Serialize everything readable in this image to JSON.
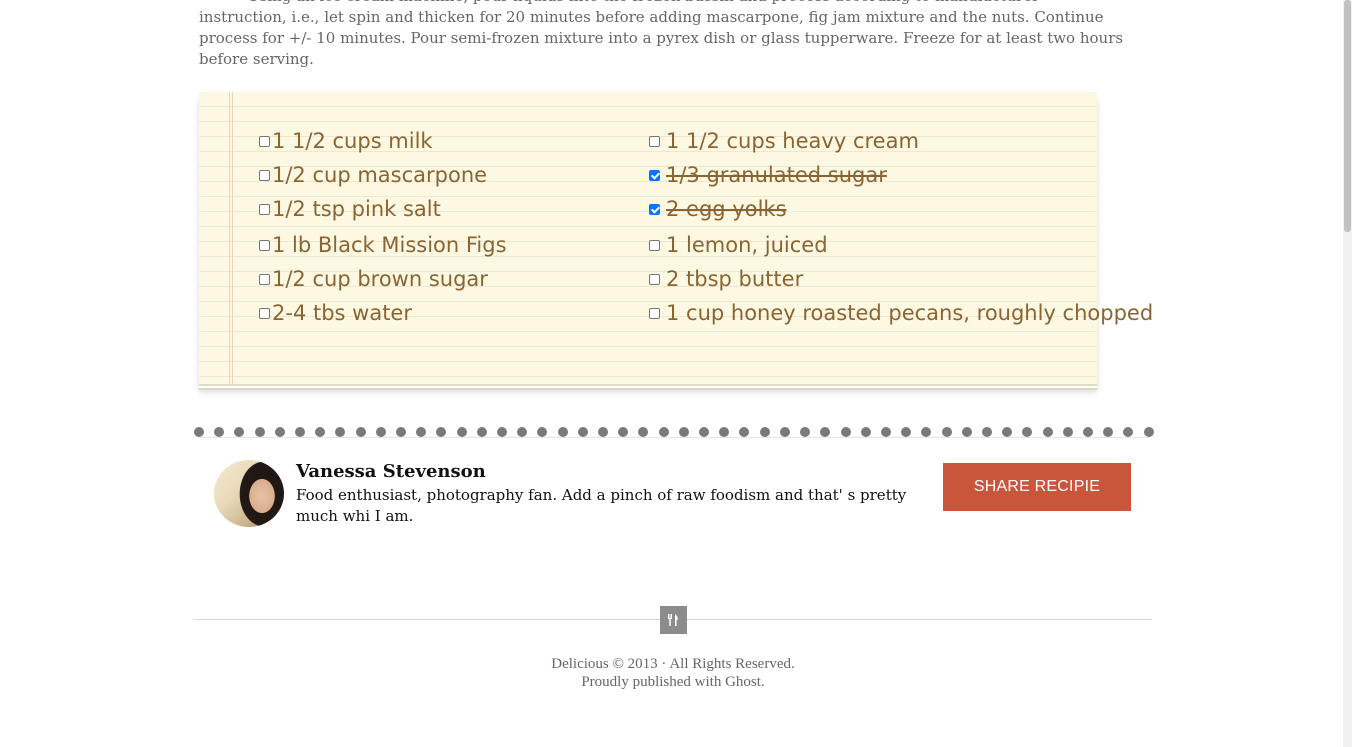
{
  "recipe": {
    "instructions": "Using an ice cream machine, pour liquids into the frozen bassin and process according to manufacturer instruction, i.e., let spin and thicken for 20 minutes before adding mascarpone, fig jam mixture and the nuts. Continue process for +/- 10 minutes. Pour semi-frozen mixture into a pyrex dish or glass tupperware. Freeze for at least two hours before serving."
  },
  "ingredients": {
    "left": [
      {
        "label": "1 1/2 cups milk",
        "checked": false
      },
      {
        "label": "1/2 cup mascarpone",
        "checked": false
      },
      {
        "label": "1/2 tsp pink salt",
        "checked": false
      },
      {
        "label": "1 lb Black Mission Figs",
        "checked": false
      },
      {
        "label": "1/2 cup brown sugar",
        "checked": false
      },
      {
        "label": "2-4 tbs water",
        "checked": false
      }
    ],
    "right": [
      {
        "label": "1 1/2 cups heavy cream",
        "checked": false
      },
      {
        "label": "1/3 granulated sugar",
        "checked": true
      },
      {
        "label": "2 egg yolks",
        "checked": true
      },
      {
        "label": "1 lemon, juiced",
        "checked": false
      },
      {
        "label": "2 tbsp butter",
        "checked": false
      },
      {
        "label": "1 cup honey roasted pecans, roughly chopped",
        "checked": false
      }
    ]
  },
  "author": {
    "name": "Vanessa Stevenson",
    "bio": "Food enthusiast, photography fan. Add a pinch of raw foodism and that' s pretty much whi I am."
  },
  "share": {
    "label": "SHARE RECIPIE"
  },
  "footer": {
    "copyright": "Delicious © 2013 · All Rights Reserved.",
    "published": "Proudly published with Ghost.",
    "logo_icon": "fork-knife-icon"
  },
  "colors": {
    "notepad_bg": "#fdf8e1",
    "ingredient_text": "#8b6434",
    "share_button": "#c9563a",
    "checkbox_checked": "#0075ff"
  }
}
